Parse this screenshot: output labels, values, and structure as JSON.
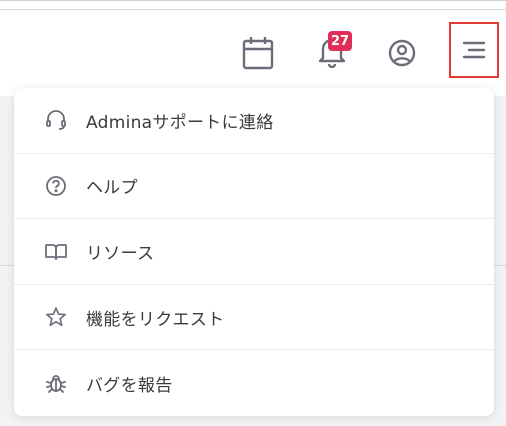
{
  "header": {
    "icons": {
      "calendar": "calendar-icon",
      "notifications": "bell-icon",
      "account": "account-circle-icon",
      "menu": "menu-icon"
    },
    "notification_count": "27"
  },
  "menu": {
    "items": [
      {
        "label": "Adminaサポートに連絡",
        "icon": "support-headset-icon"
      },
      {
        "label": "ヘルプ",
        "icon": "help-circle-icon"
      },
      {
        "label": "リソース",
        "icon": "book-open-icon"
      },
      {
        "label": "機能をリクエスト",
        "icon": "star-icon"
      },
      {
        "label": "バグを報告",
        "icon": "bug-icon"
      }
    ]
  },
  "colors": {
    "badge": "#e0305a",
    "highlight_border": "#e53935",
    "icon": "#6b6e78"
  }
}
